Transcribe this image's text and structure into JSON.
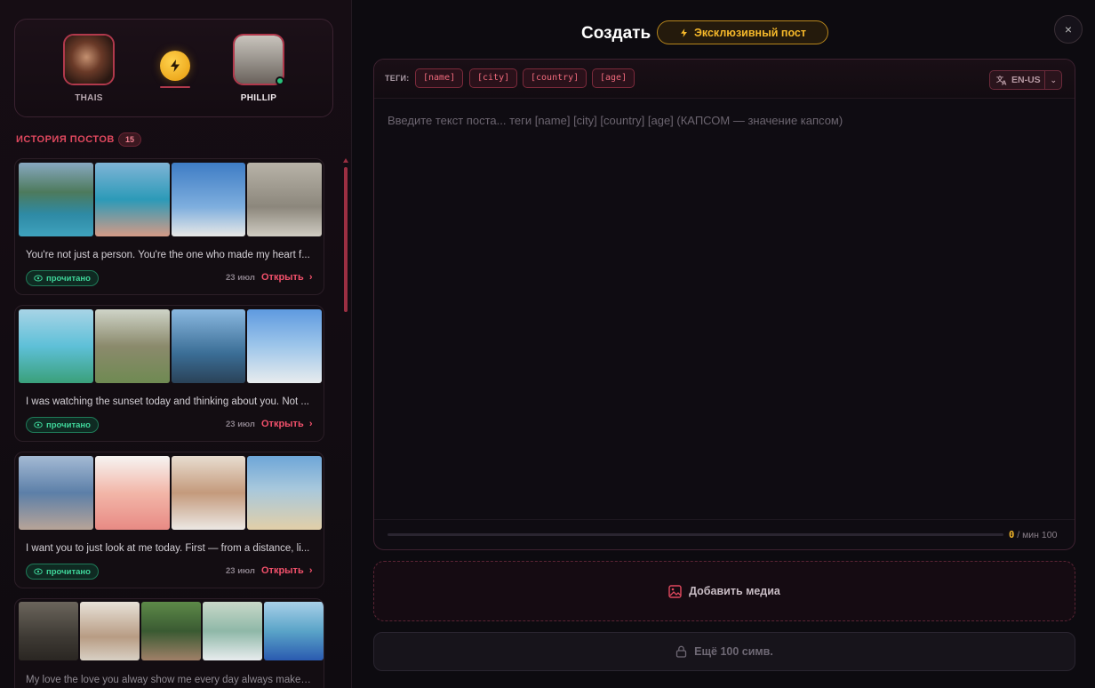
{
  "pair": {
    "left_name": "THAIS",
    "right_name": "PHILLIP"
  },
  "history": {
    "title": "ИСТОРИЯ ПОСТОВ",
    "count": "15",
    "posts": [
      {
        "text": "You're not just a person. You're the one who made my heart f...",
        "status": "прочитано",
        "date": "23 июл",
        "open": "Открыть",
        "thumbs": [
          "#3d6e86",
          "#2b8fb6",
          "#4c88c2",
          "#a9a49a"
        ]
      },
      {
        "text": "I was watching the sunset today and thinking about you. Not ...",
        "status": "прочитано",
        "date": "23 июл",
        "open": "Открыть",
        "thumbs": [
          "#6dafc9",
          "#8a8a70",
          "#5b8dbb",
          "#7aa8d9"
        ]
      },
      {
        "text": "I want you to just look at me today. First — from a distance, li...",
        "status": "прочитано",
        "date": "23 июл",
        "open": "Открыть",
        "thumbs": [
          "#6f8fb2",
          "#f0b8b0",
          "#d8b8a0",
          "#82b0d0"
        ]
      },
      {
        "text": "My love the love you alway show me every day always makes ...",
        "status": "",
        "date": "",
        "open": "",
        "thumbs": [
          "#57534c",
          "#c8bfae",
          "#4d7a4a",
          "#a8c7b8",
          "#5aa4c8"
        ]
      }
    ]
  },
  "header": {
    "title": "Создать",
    "exclusive_label": "Эксклюзивный пост",
    "close": "×"
  },
  "editor": {
    "tags_label": "ТЕГИ:",
    "tags": [
      "[name]",
      "[city]",
      "[country]",
      "[age]"
    ],
    "language": "EN-US",
    "placeholder": "Введите текст поста... теги [name] [city] [country] [age] (КАПСОМ — значение капсом)",
    "char_count": "0",
    "char_min": "/ мин 100",
    "progress": 0
  },
  "actions": {
    "add_media": "Добавить медиа",
    "more_chars": "Ещё 100 симв."
  },
  "colors": {
    "accent": "#e0485e",
    "gold": "#f5b82a",
    "read_green": "#3fd69a"
  }
}
